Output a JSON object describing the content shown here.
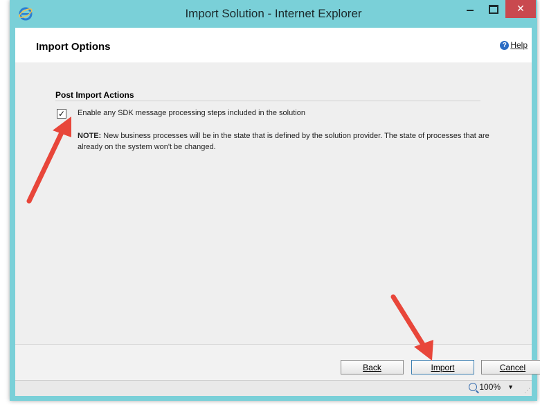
{
  "window": {
    "title": "Import Solution - Internet Explorer",
    "close_glyph": "✕",
    "icons": [
      "ie-icon",
      "minimize-icon",
      "maximize-icon",
      "close-icon"
    ]
  },
  "header": {
    "title": "Import Options",
    "help_label": "Help",
    "help_icon": "?"
  },
  "section": {
    "title": "Post Import Actions",
    "checkbox": {
      "checked": true,
      "glyph": "✓",
      "label": "Enable any SDK message processing steps included in the solution"
    },
    "note": {
      "label": "NOTE:",
      "text": " New business processes will be in the state that is defined by the solution provider. The state of processes that are already on the system won't be changed."
    }
  },
  "footer": {
    "back_label": "Back",
    "import_label": "Import",
    "cancel_label": "Cancel"
  },
  "status": {
    "zoom": "100%",
    "zoom_dropdown": "▼"
  },
  "colors": {
    "titlebar": "#7ad0d8",
    "close": "#c9494f",
    "annotation_arrow": "#e8463a"
  }
}
